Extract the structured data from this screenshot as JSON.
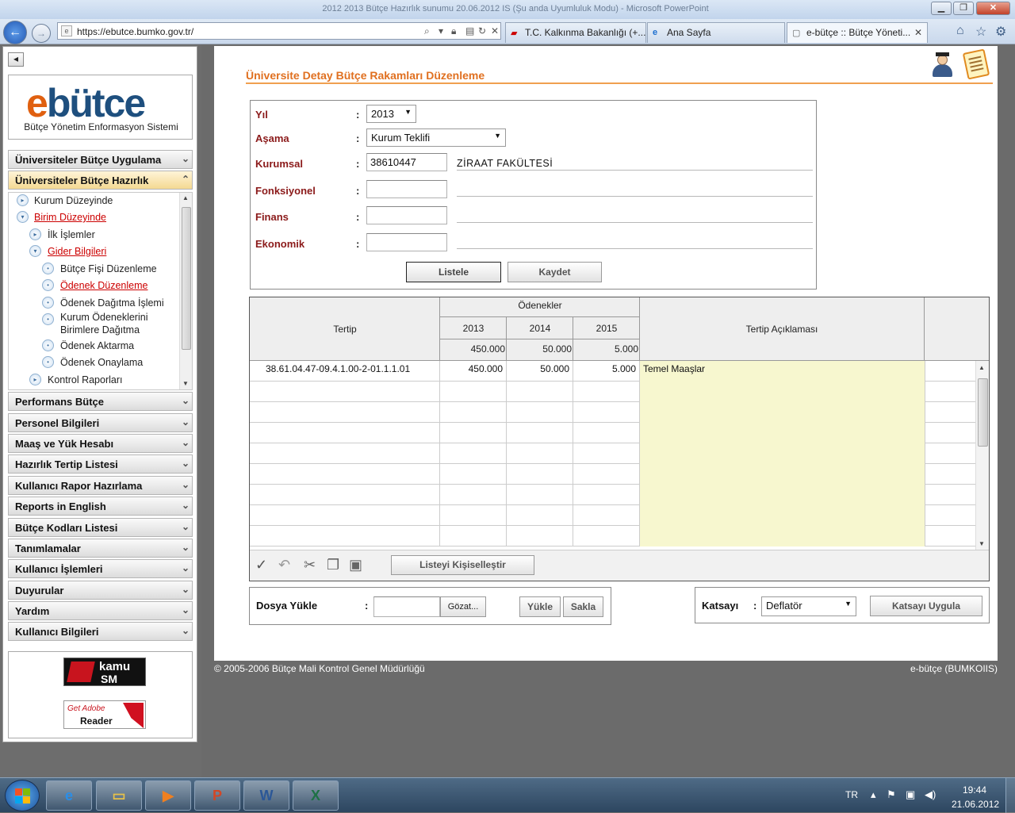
{
  "window": {
    "title": "2012 2013 Bütçe Hazırlık sunumu 20.06.2012 IS (Şu anda Uyumluluk Modu) - Microsoft PowerPoint",
    "minimize": "▁",
    "restore": "❐",
    "close": "✕"
  },
  "browser": {
    "url": "https://ebutce.bumko.gov.tr/",
    "tabs": [
      {
        "label": "T.C. Kalkınma Bakanlığı (+...",
        "icon": "flag-icon"
      },
      {
        "label": "Ana Sayfa",
        "icon": "ie-icon"
      },
      {
        "label": "e-bütçe :: Bütçe Yöneti...",
        "icon": "page-icon"
      }
    ],
    "tab_close": "✕"
  },
  "sidebar": {
    "collapse": "◂",
    "logo_sub": "Bütçe Yönetim Enformasyon Sistemi",
    "menus_top": [
      {
        "label": "Üniversiteler Bütçe Uygulama"
      },
      {
        "label": "Üniversiteler Bütçe Hazırlık"
      }
    ],
    "tree": [
      {
        "label": "Kurum Düzeyinde"
      },
      {
        "label": "Birim Düzeyinde"
      },
      {
        "label": "İlk İşlemler"
      },
      {
        "label": "Gider Bilgileri"
      },
      {
        "label": "Bütçe Fişi Düzenleme"
      },
      {
        "label": "Ödenek Düzenleme"
      },
      {
        "label": "Ödenek Dağıtma İşlemi"
      },
      {
        "label": "Kurum Ödeneklerini"
      },
      {
        "label": "Birimlere Dağıtma"
      },
      {
        "label": "Ödenek Aktarma"
      },
      {
        "label": "Ödenek Onaylama"
      },
      {
        "label": "Kontrol Raporları"
      }
    ],
    "menus_bottom": [
      {
        "label": "Performans Bütçe"
      },
      {
        "label": "Personel Bilgileri"
      },
      {
        "label": "Maaş ve Yük Hesabı"
      },
      {
        "label": "Hazırlık Tertip Listesi"
      },
      {
        "label": "Kullanıcı Rapor Hazırlama"
      },
      {
        "label": "Reports in English"
      },
      {
        "label": "Bütçe Kodları Listesi"
      },
      {
        "label": "Tanımlamalar"
      },
      {
        "label": "Kullanıcı İşlemleri"
      },
      {
        "label": "Duyurular"
      },
      {
        "label": "Yardım"
      },
      {
        "label": "Kullanıcı Bilgileri"
      }
    ],
    "badges": {
      "kamu": "kamu",
      "sm": "SM",
      "adobe_get": "Get Adobe",
      "adobe_reader": "Reader"
    }
  },
  "page": {
    "title": "Üniversite Detay Bütçe Rakamları Düzenleme",
    "form": {
      "yil_label": "Yıl",
      "yil_value": "2013",
      "asama_label": "Aşama",
      "asama_value": "Kurum Teklifi",
      "kurumsal_label": "Kurumsal",
      "kurumsal_value": "38610447",
      "kurumsal_name": "ZİRAAT FAKÜLTESİ",
      "fonksiyonel_label": "Fonksiyonel",
      "finans_label": "Finans",
      "ekonomik_label": "Ekonomik",
      "colon": ":",
      "listele": "Listele",
      "kaydet": "Kaydet"
    },
    "grid": {
      "tertip_header": "Tertip",
      "odenekler_header": "Ödenekler",
      "years": [
        "2013",
        "2014",
        "2015"
      ],
      "totals": [
        "450.000",
        "50.000",
        "5.000"
      ],
      "aciklama_header": "Tertip Açıklaması",
      "rows": [
        {
          "tertip": "38.61.04.47-09.4.1.00-2-01.1.1.01",
          "y2013": "450.000",
          "y2014": "50.000",
          "y2015": "5.000",
          "aciklama": "Temel Maaşlar"
        }
      ],
      "customize_button": "Listeyi Kişiselleştir"
    },
    "upload": {
      "label": "Dosya Yükle",
      "colon": ":",
      "browse": "Gözat...",
      "upload": "Yükle",
      "save": "Sakla"
    },
    "katsayi": {
      "label": "Katsayı",
      "colon": ":",
      "value": "Deflatör",
      "apply": "Katsayı Uygula"
    },
    "footer_left": "© 2005-2006 Bütçe Mali Kontrol Genel Müdürlüğü",
    "footer_right": "e-bütçe (BUMKOIIS)"
  },
  "taskbar": {
    "lang": "TR",
    "time": "19:44",
    "date": "21.06.2012"
  }
}
